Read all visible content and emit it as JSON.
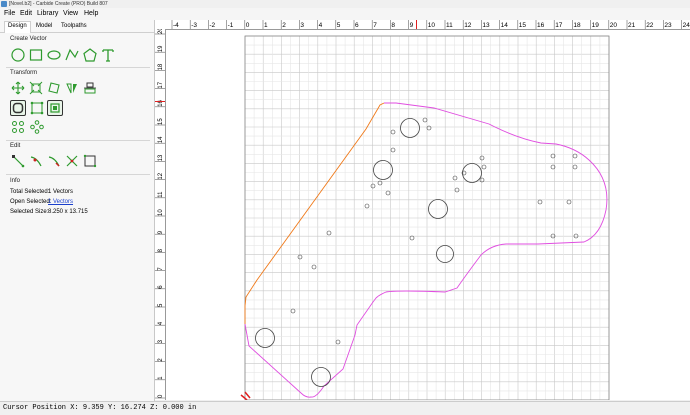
{
  "window": {
    "title": "[Novel.b2] - Carbide Create (PRO) Build 807"
  },
  "menu": [
    "File",
    "Edit",
    "Library",
    "View",
    "Help"
  ],
  "tabs": [
    "Design",
    "Model",
    "Toolpaths"
  ],
  "sections": {
    "create_vector": "Create Vector",
    "transform": "Transform",
    "edit": "Edit",
    "info": "Info"
  },
  "info": {
    "total_selected_label": "Total Selected:",
    "total_selected_value": "1 Vectors",
    "open_selected_label": "Open Selected:",
    "open_selected_value": "1 Vectors",
    "selected_size_label": "Selected Size:",
    "selected_size_value": "8.250 x 13.715"
  },
  "ruler": {
    "h_labels": [
      "-4",
      "-3",
      "-2",
      "-1",
      "0",
      "1",
      "2",
      "3",
      "4",
      "5",
      "6",
      "7",
      "8",
      "9",
      "10",
      "11",
      "12",
      "13",
      "14",
      "15",
      "16",
      "17",
      "18",
      "19",
      "20",
      "21",
      "22",
      "23",
      "24"
    ],
    "v_labels": [
      "20",
      "19",
      "18",
      "17",
      "16",
      "15",
      "14",
      "13",
      "12",
      "11",
      "10",
      "9",
      "8",
      "7",
      "6",
      "5",
      "4",
      "3",
      "2",
      "1",
      "0"
    ]
  },
  "colors": {
    "grid_minor": "#e6e6e6",
    "grid_major": "#c8c8c8",
    "selected_vector": "#f07a1a",
    "vector_path": "#e04ee0",
    "circle": "#444444",
    "cursor_marker": "#e02020",
    "tool_icon": "#2e9a2e"
  },
  "status": {
    "cursor_label": "Cursor Position",
    "x": "9.359",
    "y": "16.274",
    "z": "0.000",
    "units": "in"
  }
}
